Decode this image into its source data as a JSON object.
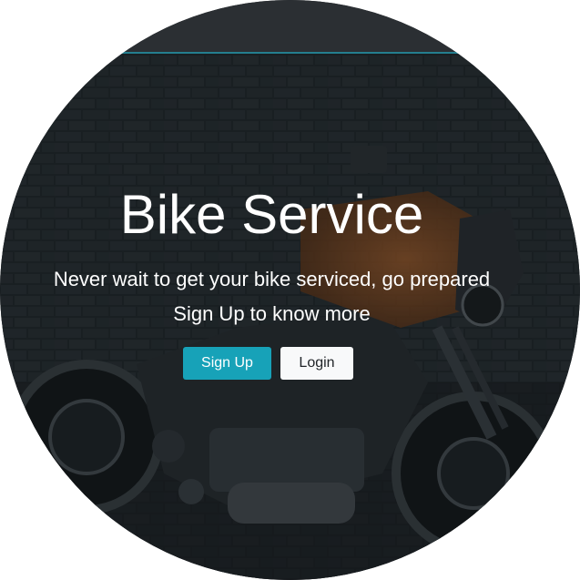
{
  "hero": {
    "title": "Bike Service",
    "tagline": "Never wait to get your bike serviced, go prepared",
    "subline": "Sign Up to know more"
  },
  "buttons": {
    "signup_label": "Sign Up",
    "login_label": "Login"
  },
  "colors": {
    "accent": "#17a2b8",
    "light_button": "#f8f9fa",
    "text": "#ffffff"
  }
}
